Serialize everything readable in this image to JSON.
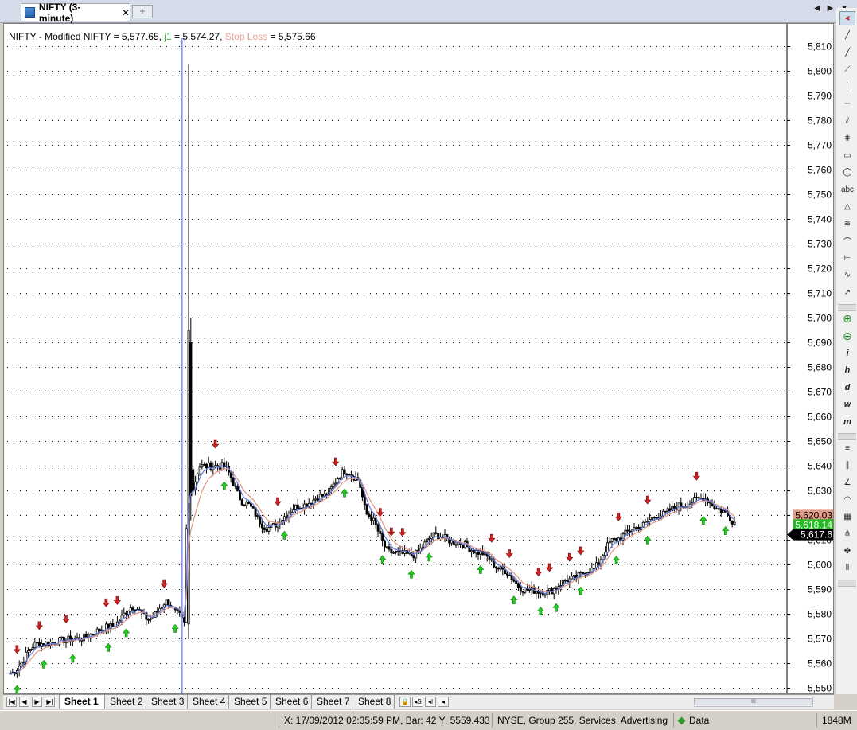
{
  "tab": {
    "title": "NIFTY (3-minute)",
    "close": "✕",
    "new_tab": "+"
  },
  "tab_nav": "◀ ▶ ▼",
  "chart_header": {
    "main": "NIFTY - Modified NIFTY = 5,577.65,",
    "j1": "j1",
    "j1_value": "= 5,574.27,",
    "stop_loss": "Stop Loss",
    "stop_loss_value": "= 5,575.66"
  },
  "colors": {
    "up_arrow": "#22cc22",
    "down_arrow": "#cc2222",
    "j1_line": "#6a7fd8",
    "stop_line": "#e39c8a",
    "cursor_line": "#8c96e8",
    "badge_sl": "#e39c8a",
    "badge_j1": "#22bb22",
    "badge_price": "#000000"
  },
  "chart_data": {
    "type": "candlestick",
    "yaxis_ticks": [
      "5,810",
      "5,800",
      "5,790",
      "5,780",
      "5,770",
      "5,760",
      "5,750",
      "5,740",
      "5,730",
      "5,720",
      "5,710",
      "5,700",
      "5,690",
      "5,680",
      "5,670",
      "5,660",
      "5,650",
      "5,640",
      "5,630",
      "5,620",
      "5,610",
      "5,600",
      "5,590",
      "5,580",
      "5,570",
      "5,560",
      "5,550"
    ],
    "ylim": [
      5547,
      5816
    ],
    "last_values": {
      "stop_loss": "5,620.03",
      "j1": "5,618.14",
      "close": "5,617.6"
    },
    "anchors": [
      [
        0,
        5556
      ],
      [
        12,
        5568
      ],
      [
        30,
        5570
      ],
      [
        45,
        5575
      ],
      [
        55,
        5583
      ],
      [
        62,
        5578
      ],
      [
        70,
        5585
      ],
      [
        75,
        5580
      ],
      [
        78,
        5576
      ],
      [
        80,
        5695
      ],
      [
        81,
        5630
      ],
      [
        85,
        5640
      ],
      [
        95,
        5640
      ],
      [
        105,
        5625
      ],
      [
        115,
        5615
      ],
      [
        130,
        5624
      ],
      [
        140,
        5628
      ],
      [
        150,
        5638
      ],
      [
        155,
        5635
      ],
      [
        160,
        5620
      ],
      [
        170,
        5605
      ],
      [
        180,
        5604
      ],
      [
        190,
        5612
      ],
      [
        200,
        5609
      ],
      [
        210,
        5605
      ],
      [
        220,
        5598
      ],
      [
        230,
        5590
      ],
      [
        240,
        5589
      ],
      [
        250,
        5594
      ],
      [
        260,
        5598
      ],
      [
        270,
        5610
      ],
      [
        280,
        5615
      ],
      [
        290,
        5620
      ],
      [
        300,
        5624
      ],
      [
        310,
        5627
      ],
      [
        318,
        5622
      ],
      [
        325,
        5617
      ]
    ],
    "spike": {
      "index": 80,
      "high": 5803,
      "low": 5570
    },
    "cursor_index": 77,
    "bar_count": 326,
    "signals": {
      "down": [
        3,
        16,
        30,
        52,
        58,
        82,
        110,
        143,
        175,
        198,
        205,
        210,
        258,
        268,
        283,
        290,
        300,
        306,
        327,
        342,
        369
      ],
      "up": [
        4,
        18,
        33,
        53,
        62,
        89,
        115,
        147,
        179,
        200,
        215,
        225,
        253,
        270,
        285,
        293,
        306,
        325,
        342,
        372,
        384
      ]
    }
  },
  "toolbar": {
    "items": [
      "cursor-arrow",
      "line",
      "ray",
      "extended-line",
      "vertical-line",
      "horizontal-line",
      "parallel-lines",
      "fibonacci",
      "rectangle",
      "ellipse",
      "text",
      "triangle",
      "fan",
      "arc",
      "gann",
      "polyline",
      "arrow",
      "zoom-in",
      "zoom-out",
      "info-i",
      "h",
      "d",
      "w",
      "m",
      "horizontal-lines",
      "vertical-lines",
      "angle",
      "rainbow",
      "grid",
      "pitchfork",
      "spiral",
      "cycle-lines"
    ],
    "labels": {
      "text": "abc",
      "i": "i",
      "h": "h",
      "d": "d",
      "w": "w",
      "m": "m"
    }
  },
  "sheets": [
    "Sheet 1",
    "Sheet 2",
    "Sheet 3",
    "Sheet 4",
    "Sheet 5",
    "Sheet 6",
    "Sheet 7",
    "Sheet 8"
  ],
  "sheet_extra": [
    "🔒",
    "◂S",
    "◂I",
    "◂"
  ],
  "scroll_grip": "III",
  "status": {
    "cursor_info": "X: 17/09/2012 02:35:59 PM, Bar: 42  Y: 5559.433",
    "symbol_info": "NYSE, Group 255, Services, Advertising",
    "data": "Data",
    "memory": "1848M"
  }
}
